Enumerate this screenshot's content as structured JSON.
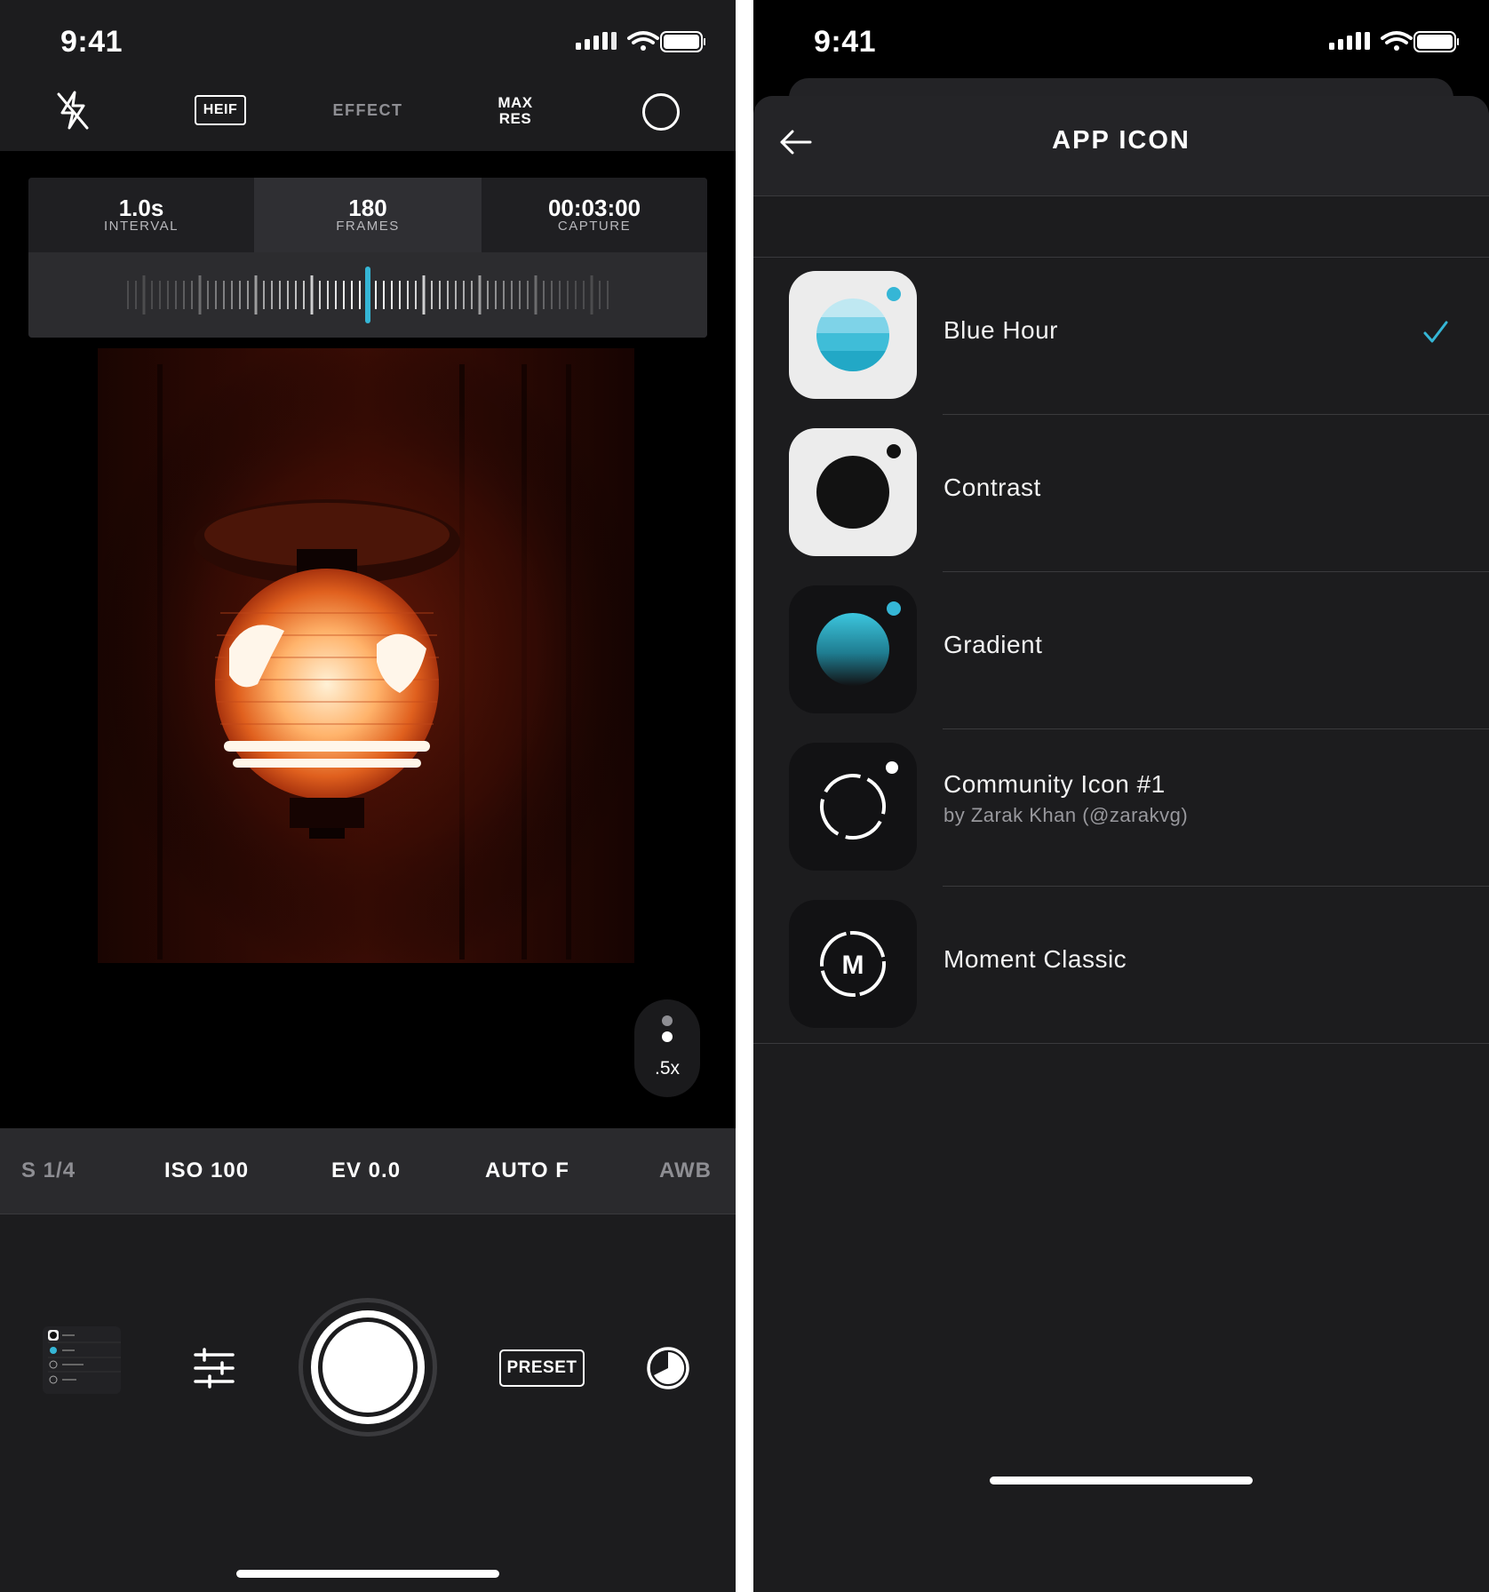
{
  "left_phone": {
    "status_bar": {
      "time": "9:41"
    },
    "top_bar": {
      "flash": "flash-off-icon",
      "format_label": "HEIF",
      "effect_label": "EFFECT",
      "max_res_line1": "MAX",
      "max_res_line2": "RES",
      "lens": "lens-circle-icon"
    },
    "timelapse": {
      "interval": {
        "value": "1.0s",
        "label": "INTERVAL"
      },
      "frames": {
        "value": "180",
        "label": "FRAMES"
      },
      "capture": {
        "value": "00:03:00",
        "label": "CAPTURE"
      },
      "accent_color": "#35b6d6"
    },
    "zoom": {
      "label": ".5x"
    },
    "settings": {
      "shutter": "S 1/4",
      "iso": "ISO 100",
      "ev": "EV 0.0",
      "focus": "AUTO F",
      "white_balance": "AWB"
    },
    "controls": {
      "preset_label": "PRESET",
      "sliders": "sliders-icon",
      "filter": "exposure-dial-icon",
      "thumbnail": "last-photo-thumbnail"
    }
  },
  "right_phone": {
    "status_bar": {
      "time": "9:41"
    },
    "header": {
      "title": "APP ICON",
      "back": "back-arrow-icon"
    },
    "accent_color": "#35b6d6",
    "icons": [
      {
        "name": "Blue Hour",
        "subtitle": "",
        "selected": true
      },
      {
        "name": "Contrast",
        "subtitle": "",
        "selected": false
      },
      {
        "name": "Gradient",
        "subtitle": "",
        "selected": false
      },
      {
        "name": "Community Icon #1",
        "subtitle": "by Zarak Khan (@zarakvg)",
        "selected": false
      },
      {
        "name": "Moment Classic",
        "subtitle": "",
        "selected": false
      }
    ],
    "moment_letter": "M"
  }
}
